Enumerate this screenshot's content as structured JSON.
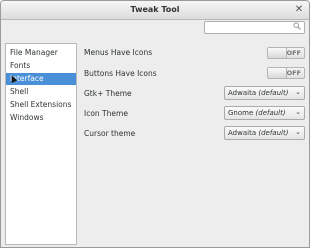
{
  "window": {
    "title": "Tweak Tool",
    "close_glyph": "✕"
  },
  "search": {
    "placeholder": "",
    "icon": "search-icon"
  },
  "sidebar": {
    "items": [
      {
        "label": "File Manager",
        "selected": false
      },
      {
        "label": "Fonts",
        "selected": false
      },
      {
        "label": "Interface",
        "selected": true
      },
      {
        "label": "Shell",
        "selected": false
      },
      {
        "label": "Shell Extensions",
        "selected": false
      },
      {
        "label": "Windows",
        "selected": false
      }
    ]
  },
  "settings": {
    "menus_have_icons": {
      "label": "Menus Have Icons",
      "state": "OFF"
    },
    "buttons_have_icons": {
      "label": "Buttons Have Icons",
      "state": "OFF"
    },
    "gtk_theme": {
      "label": "Gtk+ Theme",
      "value": "Adwaita",
      "note": "(default)"
    },
    "icon_theme": {
      "label": "Icon Theme",
      "value": "Gnome",
      "note": "(default)"
    },
    "cursor_theme": {
      "label": "Cursor theme",
      "value": "Adwaita",
      "note": "(default)"
    }
  },
  "colors": {
    "selection": "#4a90d9",
    "window_bg": "#ededed"
  }
}
